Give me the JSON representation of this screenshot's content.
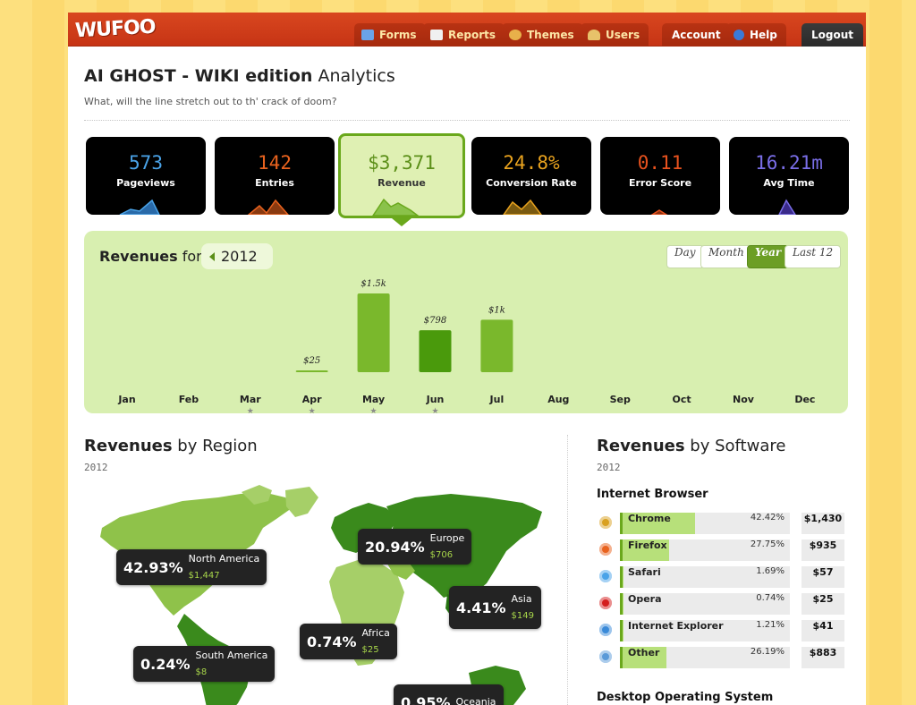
{
  "header": {
    "logo": "WUFOO",
    "nav": [
      {
        "label": "Forms",
        "icon": "forms-icon",
        "color": "#6aa3e8"
      },
      {
        "label": "Reports",
        "icon": "reports-icon",
        "color": "#f0f0f0"
      },
      {
        "label": "Themes",
        "icon": "themes-icon",
        "color": "#e8b04a"
      },
      {
        "label": "Users",
        "icon": "users-icon",
        "color": "#e8c26a"
      }
    ],
    "account": "Account",
    "help": "Help",
    "logout": "Logout"
  },
  "page": {
    "title_bold": "AI GHOST - WIKI edition",
    "title_rest": "Analytics",
    "subtitle": "What, will the line stretch out to th' crack of doom?"
  },
  "stats": [
    {
      "value": "573",
      "label": "Pageviews",
      "color": "#4aa3e8"
    },
    {
      "value": "142",
      "label": "Entries",
      "color": "#e8621e"
    },
    {
      "value": "$3,371",
      "label": "Revenue",
      "color": "#5b8f18"
    },
    {
      "value": "24.8%",
      "label": "Conversion Rate",
      "color": "#e8a21e"
    },
    {
      "value": "0.11",
      "label": "Error Score",
      "color": "#e8521e"
    },
    {
      "value": "16.21m",
      "label": "Avg Time",
      "color": "#7a6ee8"
    }
  ],
  "revenue": {
    "title_bold": "Revenues",
    "title_rest": "for",
    "year": "2012",
    "periods": [
      "Day",
      "Month",
      "Year",
      "Last 12"
    ],
    "selected_period": "Year"
  },
  "chart_data": {
    "type": "bar",
    "categories": [
      "Jan",
      "Feb",
      "Mar",
      "Apr",
      "May",
      "Jun",
      "Jul",
      "Aug",
      "Sep",
      "Oct",
      "Nov",
      "Dec"
    ],
    "values": [
      0,
      0,
      0,
      25,
      1500,
      798,
      1000,
      0,
      0,
      0,
      0,
      0
    ],
    "labels": [
      "",
      "",
      "",
      "$25",
      "$1.5k",
      "$798",
      "$1k",
      "",
      "",
      "",
      "",
      ""
    ],
    "starred": [
      false,
      false,
      true,
      true,
      true,
      true,
      false,
      false,
      false,
      false,
      false,
      false
    ],
    "highlight": "Jun",
    "ylim": [
      0,
      1500
    ]
  },
  "region": {
    "title_bold": "Revenues",
    "title_rest": "by Region",
    "year": "2012",
    "tips": [
      {
        "pct": "42.93%",
        "name": "North America",
        "amt": "$1,447"
      },
      {
        "pct": "20.94%",
        "name": "Europe",
        "amt": "$706"
      },
      {
        "pct": "4.41%",
        "name": "Asia",
        "amt": "$149"
      },
      {
        "pct": "0.74%",
        "name": "Africa",
        "amt": "$25"
      },
      {
        "pct": "0.24%",
        "name": "South America",
        "amt": "$8"
      },
      {
        "pct": "0.95%",
        "name": "Oceania",
        "amt": ""
      }
    ]
  },
  "software": {
    "title_bold": "Revenues",
    "title_rest": "by Software",
    "year": "2012",
    "browser_heading": "Internet Browser",
    "browsers": [
      {
        "name": "Chrome",
        "pct": "42.42%",
        "amt": "$1,430",
        "share": 0.4242,
        "icon": "chrome-icon",
        "color": "#d9a020"
      },
      {
        "name": "Firefox",
        "pct": "27.75%",
        "amt": "$935",
        "share": 0.2775,
        "icon": "firefox-icon",
        "color": "#e8621e"
      },
      {
        "name": "Safari",
        "pct": "1.69%",
        "amt": "$57",
        "share": 0.0169,
        "icon": "safari-icon",
        "color": "#4aa3e8"
      },
      {
        "name": "Opera",
        "pct": "0.74%",
        "amt": "$25",
        "share": 0.0074,
        "icon": "opera-icon",
        "color": "#d41e1e"
      },
      {
        "name": "Internet Explorer",
        "pct": "1.21%",
        "amt": "$41",
        "share": 0.0121,
        "icon": "ie-icon",
        "color": "#3a8ad8"
      },
      {
        "name": "Other",
        "pct": "26.19%",
        "amt": "$883",
        "share": 0.2619,
        "icon": "globe-icon",
        "color": "#5a9ad8"
      }
    ],
    "os_heading": "Desktop Operating System"
  }
}
